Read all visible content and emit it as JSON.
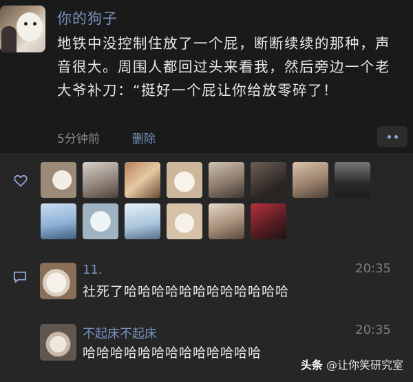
{
  "post": {
    "username": "你的狗子",
    "text": "地铁中没控制住放了一个屁，断断续续的那种，声音很大。周围人都回过头来看我，然后旁边一个老大爷补刀：“挺好一个屁让你给放零碎了！",
    "time_ago": "5分钟前",
    "delete_label": "删除",
    "more_icon": "more-dots-icon"
  },
  "likes": {
    "icon": "heart-icon",
    "liker_count": 14
  },
  "comments": [
    {
      "name": "11.",
      "time": "20:35",
      "text": "社死了哈哈哈哈哈哈哈哈哈哈哈哈"
    },
    {
      "name": "不起床不起床",
      "time": "20:35",
      "text": "哈哈哈哈哈哈哈哈哈哈哈哈哈"
    }
  ],
  "watermark": {
    "brand": "头条",
    "handle": "@让你笑研究室"
  },
  "colors": {
    "background": "#1a1a1a",
    "panel": "#262626",
    "link_blue": "#7a93c2",
    "meta_grey": "#8a8a8a"
  }
}
